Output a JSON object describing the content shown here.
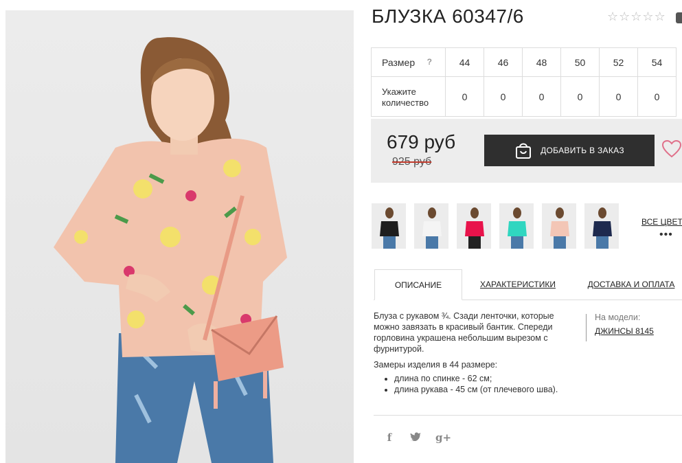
{
  "product": {
    "title": "БЛУЗКА 60347/6",
    "rating_stars": 5
  },
  "sizes": {
    "size_label": "Размер",
    "help_mark": "?",
    "qty_label": "Укажите количество",
    "items": [
      {
        "size": "44",
        "qty": "0"
      },
      {
        "size": "46",
        "qty": "0"
      },
      {
        "size": "48",
        "qty": "0"
      },
      {
        "size": "50",
        "qty": "0"
      },
      {
        "size": "52",
        "qty": "0"
      },
      {
        "size": "54",
        "qty": "0"
      }
    ]
  },
  "price": {
    "current": "679 руб",
    "old": "925 руб",
    "order_button": "ДОБАВИТЬ В ЗАКАЗ",
    "accent": "#c0392b",
    "button_color": "#2f2f2f"
  },
  "colors": {
    "all_colors_label": "ВСЕ ЦВЕТА",
    "more": "•••",
    "swatches": [
      "#1e1e1e",
      "#f4f4f4",
      "#e8134b",
      "#30d6c0",
      "#f3c6b6",
      "#1e2a4e"
    ]
  },
  "tabs": [
    {
      "label": "ОПИСАНИЕ",
      "active": true
    },
    {
      "label": "ХАРАКТЕРИСТИКИ",
      "active": false
    },
    {
      "label": "ДОСТАВКА И ОПЛАТА",
      "active": false
    }
  ],
  "description": {
    "text": "Блуза с рукавом ¾. Сзади ленточки, которые можно завязать в красивый бантик. Спереди горловина украшена небольшим вырезом с фурнитурой.",
    "measure_title": "Замеры изделия в 44 размере:",
    "measures": [
      "длина по спинке - 62 см;",
      "длина рукава - 45 см (от плечевого шва)."
    ]
  },
  "model": {
    "label": "На модели:",
    "link": "ДЖИНСЫ 8145"
  },
  "social": {
    "facebook": "f",
    "twitter": "t",
    "google": "g+"
  }
}
